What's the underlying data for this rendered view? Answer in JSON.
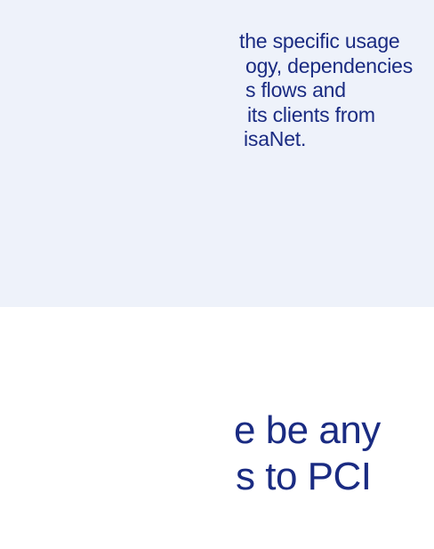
{
  "card": {
    "lines": [
      "the specific usage",
      "ogy, dependencies",
      "s flows and",
      "its clients from",
      "isaNet."
    ]
  },
  "heading": {
    "lines": [
      "e be any",
      "s to PCI"
    ]
  },
  "colors": {
    "card_background": "#eef2fa",
    "text": "#1a2b82",
    "page_background": "#ffffff"
  }
}
